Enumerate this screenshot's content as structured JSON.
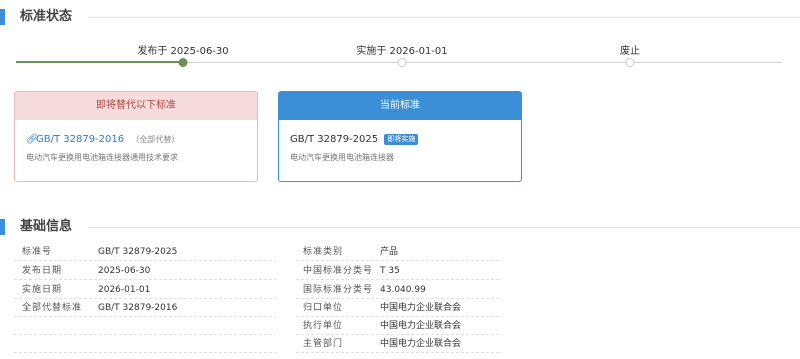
{
  "status_section": {
    "title": "标准状态"
  },
  "timeline": {
    "published": "发布于 2025-06-30",
    "implemented": "实施于 2026-01-01",
    "abolished": "废止"
  },
  "replaced_card": {
    "header": "即将替代以下标准",
    "std_no": "GB/T 32879-2016",
    "scope": "（全部代替）",
    "desc": "电动汽车更换用电池箱连接器通用技术要求"
  },
  "current_card": {
    "header": "当前标准",
    "std_no": "GB/T 32879-2025",
    "badge": "即将实施",
    "desc": "电动汽车更换用电池箱连接器"
  },
  "basic_section": {
    "title": "基础信息"
  },
  "info_left": [
    {
      "label": "标准号",
      "value": "GB/T 32879-2025"
    },
    {
      "label": "发布日期",
      "value": "2025-06-30"
    },
    {
      "label": "实施日期",
      "value": "2026-01-01"
    },
    {
      "label": "全部代替标准",
      "value": "GB/T 32879-2016"
    }
  ],
  "info_right": [
    {
      "label": "标准类别",
      "value": "产品"
    },
    {
      "label": "中国标准分类号",
      "value": "T 35"
    },
    {
      "label": "国际标准分类号",
      "value": "43.040.99"
    },
    {
      "label": "归口单位",
      "value": "中国电力企业联合会"
    },
    {
      "label": "执行单位",
      "value": "中国电力企业联合会"
    },
    {
      "label": "主管部门",
      "value": "中国电力企业联合会"
    }
  ],
  "colors": {
    "accent": "#3b8fd6",
    "done": "#6b8f57",
    "warn_bg": "#f6dcdc",
    "warn_text": "#b0473f",
    "link": "#2f7cc7"
  },
  "icons": {
    "replaced_link": "link-icon"
  }
}
